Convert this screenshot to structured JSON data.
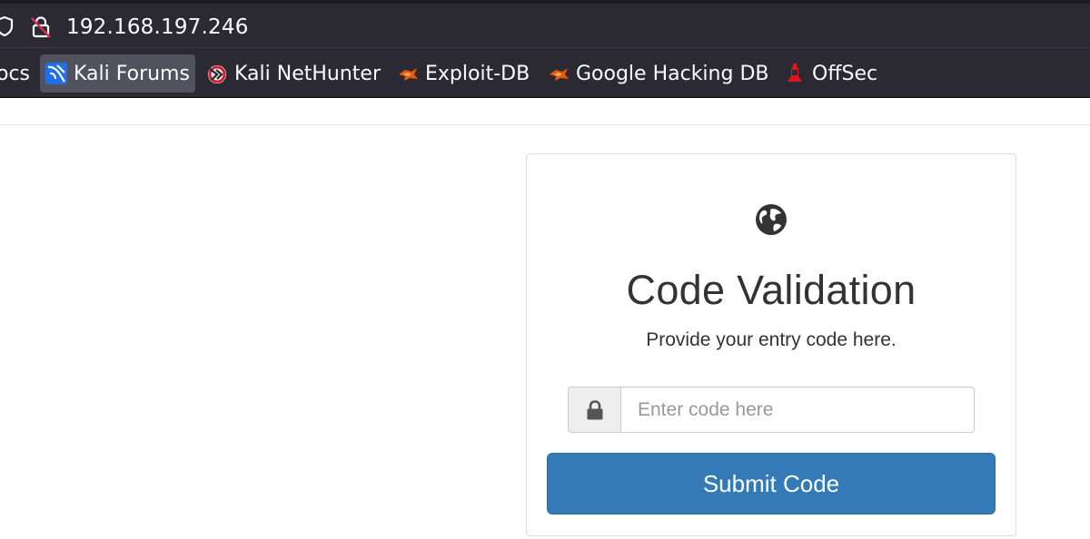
{
  "browser": {
    "url": "192.168.197.246",
    "bookmarks": [
      {
        "label": "ocs",
        "icon": "docs-icon"
      },
      {
        "label": "Kali Forums",
        "icon": "kali-forums-icon",
        "active": true
      },
      {
        "label": "Kali NetHunter",
        "icon": "nethunter-icon"
      },
      {
        "label": "Exploit-DB",
        "icon": "exploit-db-icon"
      },
      {
        "label": "Google Hacking DB",
        "icon": "ghdb-icon"
      },
      {
        "label": "OffSec",
        "icon": "offsec-icon"
      }
    ]
  },
  "card": {
    "icon": "globe-icon",
    "title": "Code Validation",
    "subtitle": "Provide your entry code here.",
    "input": {
      "icon": "lock-icon",
      "placeholder": "Enter code here",
      "value": ""
    },
    "submit_label": "Submit Code"
  },
  "colors": {
    "browser_chrome": "#2b2a33",
    "active_bookmark": "#52525e",
    "primary_button": "#337ab7",
    "text": "#333333"
  }
}
